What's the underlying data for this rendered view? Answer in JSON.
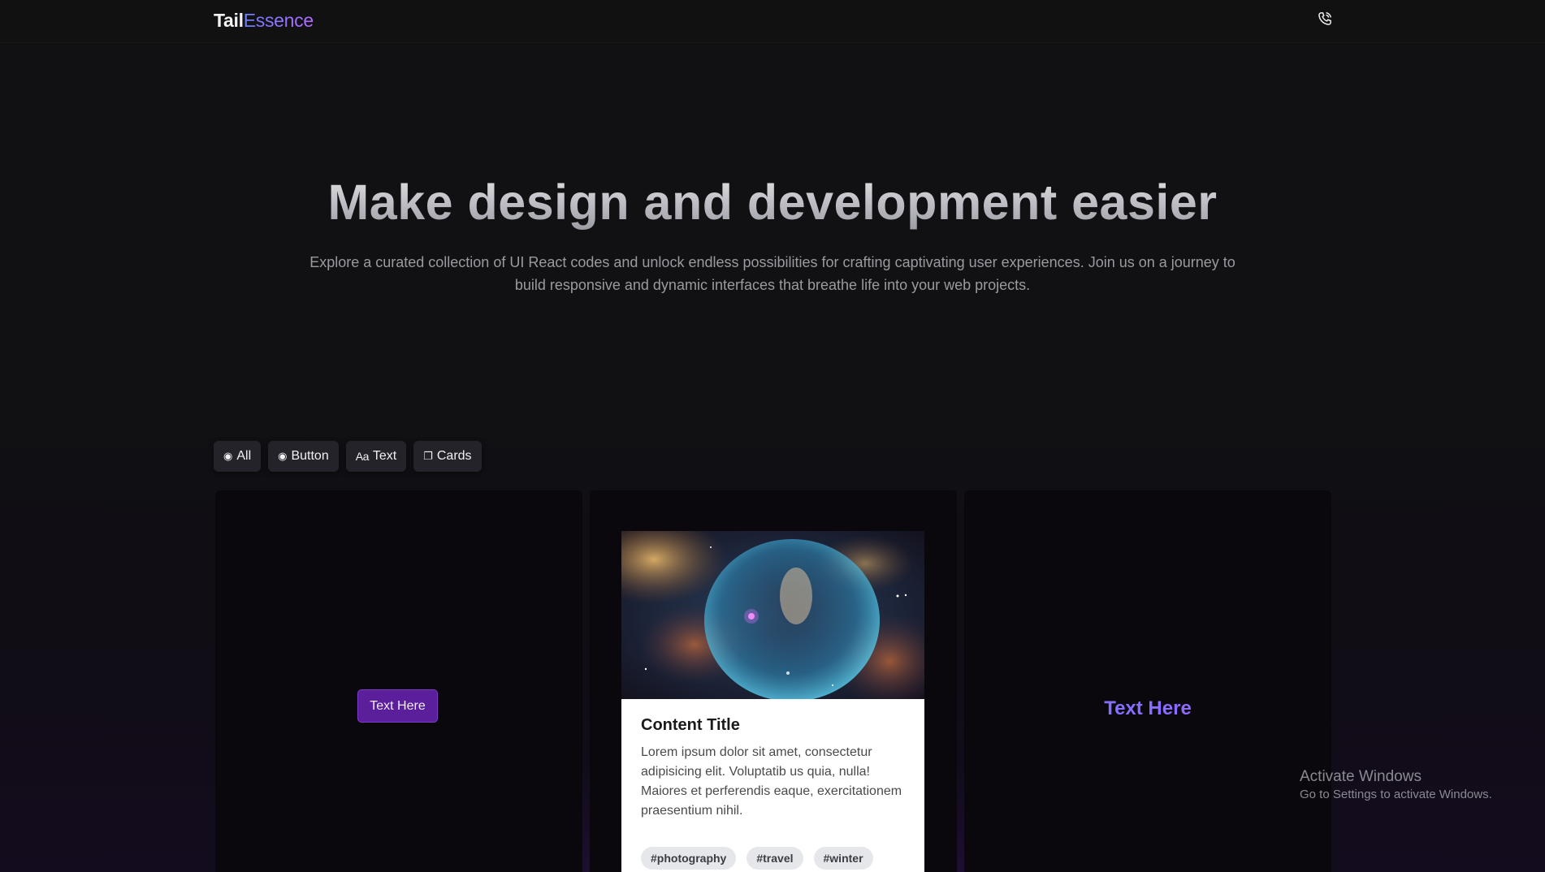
{
  "top_loader": {
    "progress": 0.2
  },
  "navbar": {
    "logo_part1": "Tail",
    "logo_part2": "Essence",
    "phone_icon": "phone-icon"
  },
  "hero": {
    "title": "Make design and development easier",
    "subtitle": "Explore a curated collection of UI React codes and unlock endless possibilities for crafting captivating user experiences. Join us on a journey to build responsive and dynamic interfaces that breathe life into your web projects."
  },
  "filters": [
    {
      "icon": "radio-icon",
      "glyph": "◉",
      "label": "All"
    },
    {
      "icon": "radio-icon",
      "glyph": "◉",
      "label": "Button"
    },
    {
      "icon": "text-icon",
      "glyph": "Aa",
      "label": "Text"
    },
    {
      "icon": "cards-icon",
      "glyph": "❐",
      "label": "Cards"
    }
  ],
  "panels": {
    "button_demo": {
      "label": "Text Here"
    },
    "card_demo": {
      "title": "Content Title",
      "body": "Lorem ipsum dolor sit amet, consectetur adipisicing elit. Voluptatib us quia, nulla! Maiores et perferendis eaque, exercitationem praesentium nihil.",
      "tags": [
        "#photography",
        "#travel",
        "#winter"
      ]
    },
    "text_demo": {
      "label": "Text Here"
    }
  },
  "colors": {
    "accent_purple": "#5b1f9c",
    "gradient_start": "#6e7dff",
    "gradient_end": "#a45cff",
    "loader_blue": "#1f6bd6"
  },
  "watermark": {
    "title": "Activate Windows",
    "subtitle": "Go to Settings to activate Windows."
  }
}
